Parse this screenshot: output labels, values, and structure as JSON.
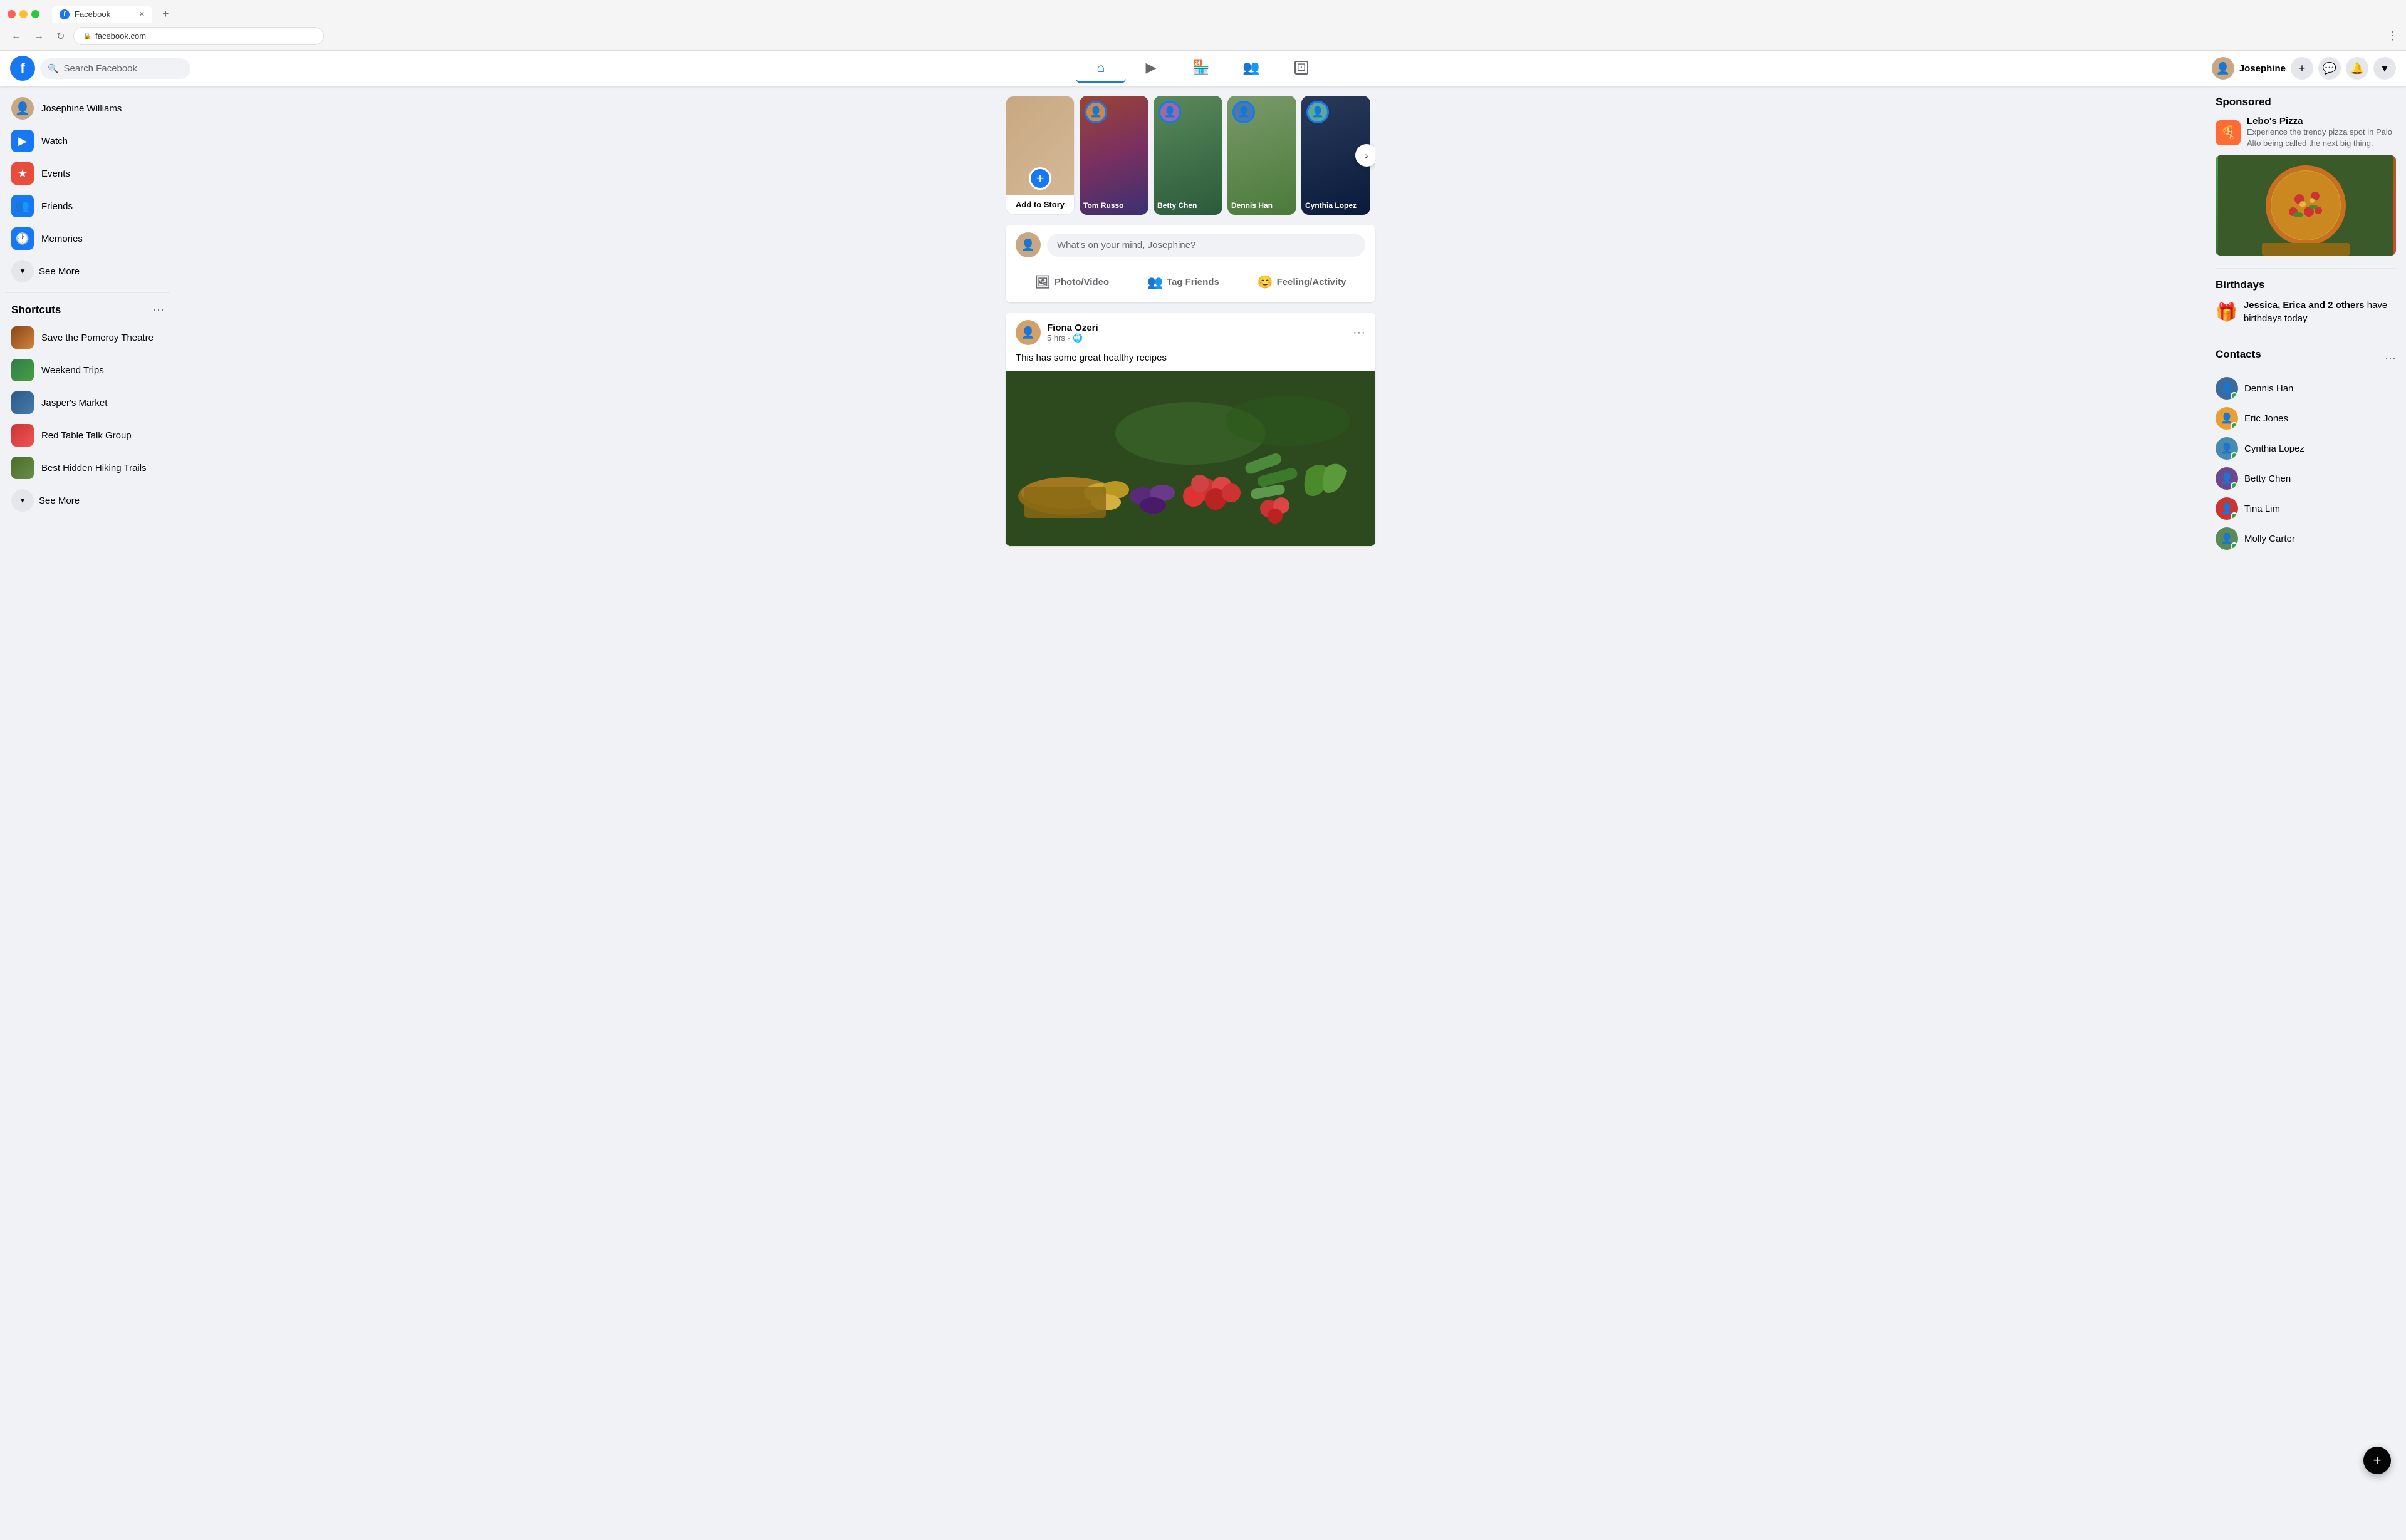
{
  "browser": {
    "tab_title": "Facebook",
    "tab_favicon": "f",
    "url": "facebook.com",
    "new_tab_symbol": "+"
  },
  "navbar": {
    "logo": "f",
    "search_placeholder": "Search Facebook",
    "user_name": "Josephine",
    "nav_icons": [
      {
        "id": "home",
        "symbol": "⌂",
        "active": true
      },
      {
        "id": "video",
        "symbol": "▶",
        "active": false
      },
      {
        "id": "marketplace",
        "symbol": "🏪",
        "active": false
      },
      {
        "id": "groups",
        "symbol": "👥",
        "active": false
      },
      {
        "id": "pages",
        "symbol": "⊡",
        "active": false
      }
    ],
    "action_add": "+",
    "action_messenger": "💬",
    "action_notifications": "🔔",
    "action_dropdown": "▾"
  },
  "sidebar": {
    "user_name": "Josephine Williams",
    "items": [
      {
        "id": "watch",
        "label": "Watch",
        "icon_type": "watch"
      },
      {
        "id": "events",
        "label": "Events",
        "icon_type": "events"
      },
      {
        "id": "friends",
        "label": "Friends",
        "icon_type": "friends"
      },
      {
        "id": "memories",
        "label": "Memories",
        "icon_type": "memories"
      }
    ],
    "see_more_label": "See More",
    "shortcuts_title": "Shortcuts",
    "shortcuts": [
      {
        "id": "pomeroy",
        "label": "Save the Pomeroy Theatre",
        "color": "sc-pomeroy"
      },
      {
        "id": "weekend",
        "label": "Weekend Trips",
        "color": "sc-weekend"
      },
      {
        "id": "jasper",
        "label": "Jasper's Market",
        "color": "sc-jasper"
      },
      {
        "id": "redtable",
        "label": "Red Table Talk Group",
        "color": "sc-redtable"
      },
      {
        "id": "hiking",
        "label": "Best Hidden Hiking Trails",
        "color": "sc-hiking"
      }
    ],
    "shortcuts_see_more_label": "See More"
  },
  "stories": [
    {
      "id": "add",
      "type": "add",
      "label": "Add to Story"
    },
    {
      "id": "tom",
      "type": "friend",
      "name": "Tom Russo",
      "bg": "story-1"
    },
    {
      "id": "betty",
      "type": "friend",
      "name": "Betty Chen",
      "bg": "story-2"
    },
    {
      "id": "dennis",
      "type": "friend",
      "name": "Dennis Han",
      "bg": "story-3"
    },
    {
      "id": "cynthia",
      "type": "friend",
      "name": "Cynthia Lopez",
      "bg": "story-5"
    }
  ],
  "composer": {
    "placeholder": "What's on your mind, Josephine?",
    "actions": [
      {
        "id": "photo",
        "label": "Photo/Video",
        "icon": "🖼",
        "color": "#45bd62"
      },
      {
        "id": "tag",
        "label": "Tag Friends",
        "icon": "👥",
        "color": "#1877f2"
      },
      {
        "id": "feeling",
        "label": "Feeling/Activity",
        "icon": "😊",
        "color": "#f7b928"
      }
    ]
  },
  "posts": [
    {
      "id": "post1",
      "author": "Fiona Ozeri",
      "time": "5 hrs",
      "privacy": "🌐",
      "text": "This has some great healthy recipes",
      "has_image": true
    }
  ],
  "right_sidebar": {
    "sponsored_title": "Sponsored",
    "ad": {
      "name": "Lebo's Pizza",
      "description": "Experience the trendy pizza spot in Palo Alto being called the next big thing."
    },
    "birthdays_title": "Birthdays",
    "birthday_text_prefix": "Jessica, Erica",
    "birthday_text_others": "2 others",
    "birthday_text_suffix": "have birthdays today",
    "contacts_title": "Contacts",
    "contacts": [
      {
        "id": "dennis",
        "name": "Dennis Han",
        "color": "av-dennis"
      },
      {
        "id": "eric",
        "name": "Eric Jones",
        "color": "av-eric"
      },
      {
        "id": "cynthia",
        "name": "Cynthia Lopez",
        "color": "av-cynthia"
      },
      {
        "id": "betty",
        "name": "Betty Chen",
        "color": "av-betty"
      },
      {
        "id": "tina",
        "name": "Tina Lim",
        "color": "av-tina"
      },
      {
        "id": "molly",
        "name": "Molly Carter",
        "color": "av-molly"
      }
    ]
  }
}
